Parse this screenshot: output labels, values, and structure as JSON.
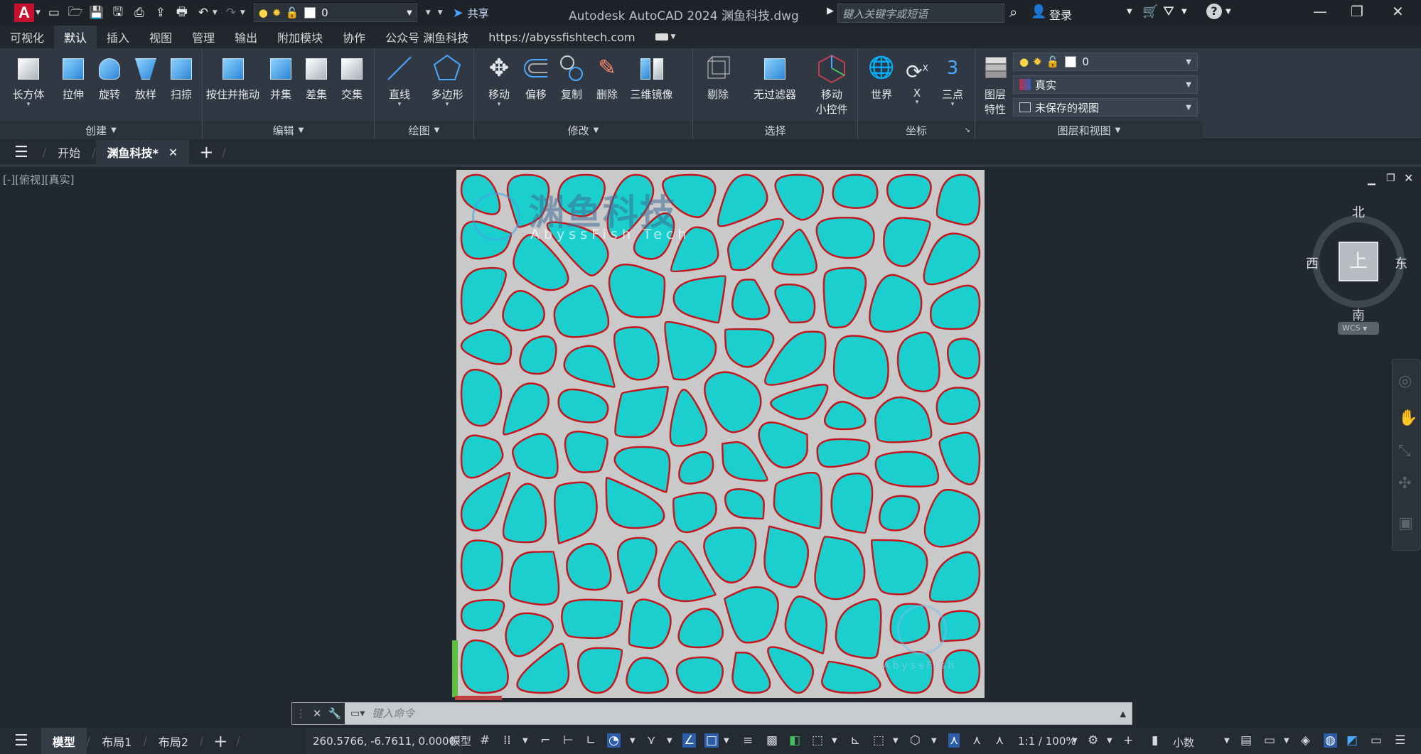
{
  "titlebar": {
    "app_logo": "A",
    "layer_value": "0",
    "share_label": "共享",
    "title": "Autodesk AutoCAD 2024    渊鱼科技.dwg",
    "search_placeholder": "键入关键字或短语",
    "login_label": "登录"
  },
  "menu": [
    "可视化",
    "默认",
    "插入",
    "视图",
    "管理",
    "输出",
    "附加模块",
    "协作",
    "公众号 渊鱼科技",
    "https://abyssfishtech.com"
  ],
  "menu_active_index": 1,
  "ribbon": {
    "create": {
      "title": "创建",
      "tools": [
        "长方体",
        "拉伸",
        "旋转",
        "放样",
        "扫掠"
      ]
    },
    "edit": {
      "title": "编辑",
      "tools": [
        "按住并拖动",
        "并集",
        "差集",
        "交集"
      ]
    },
    "draw": {
      "title": "绘图",
      "tools": [
        "直线",
        "多边形"
      ]
    },
    "modify": {
      "title": "修改",
      "tools": [
        "移动",
        "偏移",
        "复制",
        "删除",
        "三维镜像"
      ]
    },
    "select": {
      "title": "选择",
      "tools": [
        "剔除",
        "无过滤器",
        "移动\n小控件"
      ],
      "gizmo_line1": "移动",
      "gizmo_line2": "小控件"
    },
    "coords": {
      "title": "坐标",
      "tools": [
        "世界",
        "X",
        "三点"
      ],
      "x_glyph": "X",
      "three_glyph": "3"
    },
    "layers": {
      "title": "图层和视图",
      "layer_props_line1": "图层",
      "layer_props_line2": "特性",
      "layer_combo": "0",
      "visual_style": "真实",
      "view_combo": "未保存的视图"
    }
  },
  "doctabs": {
    "start": "开始",
    "file": "渊鱼科技*"
  },
  "viewport": {
    "label": "[-][俯视][真实]",
    "watermark_cn": "渊鱼科技",
    "watermark_en": "AbyssFish Tech",
    "watermark_small": "AbyssFish"
  },
  "viewcube": {
    "north": "北",
    "south": "南",
    "east": "东",
    "west": "西",
    "face": "上",
    "wcs": "WCS"
  },
  "command": {
    "placeholder": "键入命令"
  },
  "statusbar": {
    "tabs": [
      "模型",
      "布局1",
      "布局2"
    ],
    "coords": "260.5766, -6.7611, 0.0000",
    "model_label": "模型",
    "scale": "1:1 / 100%",
    "units": "小数"
  },
  "colors": {
    "cell_fill": "#1ccfcf",
    "cell_edge": "#c4161c",
    "board": "#c9c9c9",
    "accent": "#2b5da8"
  }
}
